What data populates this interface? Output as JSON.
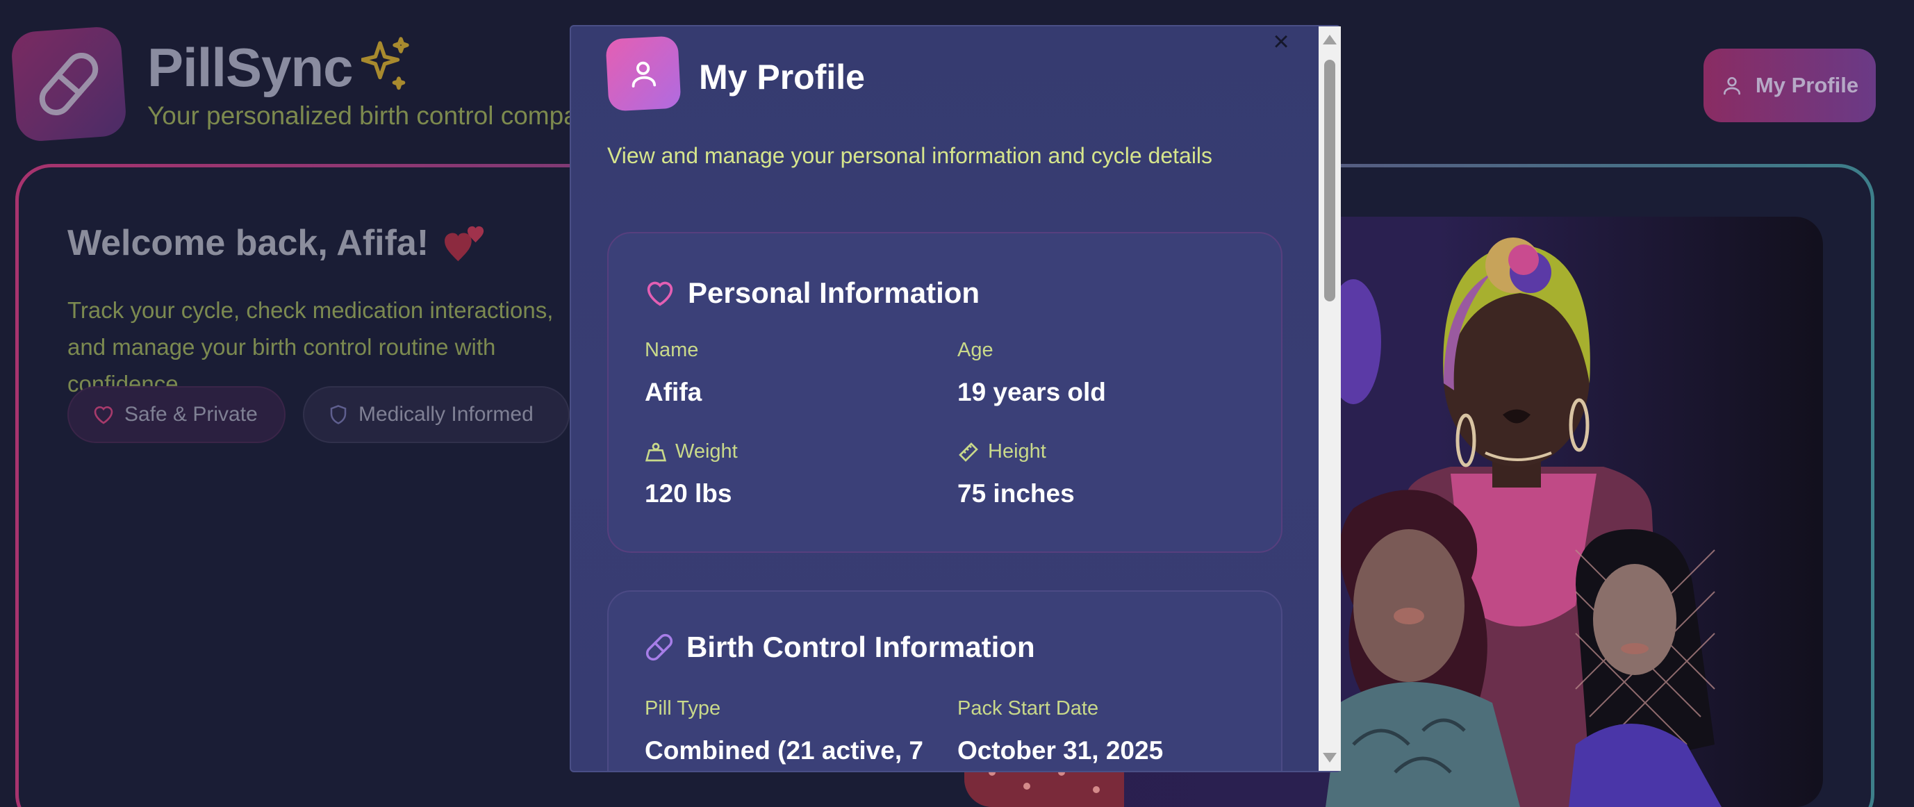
{
  "app": {
    "title": "PillSync",
    "subtitle": "Your personalized birth control companion",
    "profile_button": "My Profile",
    "logo_icon": "pill-icon",
    "title_icon": "sparkle-icon"
  },
  "welcome": {
    "heading": "Welcome back, Afifa!",
    "text": "Track your cycle, check medication interactions, and manage your birth control routine with confidence.",
    "chips": [
      {
        "label": "Safe & Private",
        "icon": "heart-icon"
      },
      {
        "label": "Medically Informed",
        "icon": "shield-icon"
      }
    ]
  },
  "modal": {
    "close": "×",
    "title": "My Profile",
    "description": "View and manage your personal information and cycle details",
    "personal": {
      "heading": "Personal Information",
      "name_label": "Name",
      "name_value": "Afifa",
      "age_label": "Age",
      "age_value": "19 years old",
      "weight_label": "Weight",
      "weight_value": "120 lbs",
      "height_label": "Height",
      "height_value": "75 inches"
    },
    "birth_control": {
      "heading": "Birth Control Information",
      "pill_type_label": "Pill Type",
      "pill_type_value": "Combined (21 active, 7",
      "pack_start_label": "Pack Start Date",
      "pack_start_value": "October 31, 2025"
    }
  },
  "colors": {
    "accent_pink": "#e45fb3",
    "accent_purple": "#b06be0",
    "label_green": "#c9d98a",
    "modal_bg": "#383d73"
  }
}
